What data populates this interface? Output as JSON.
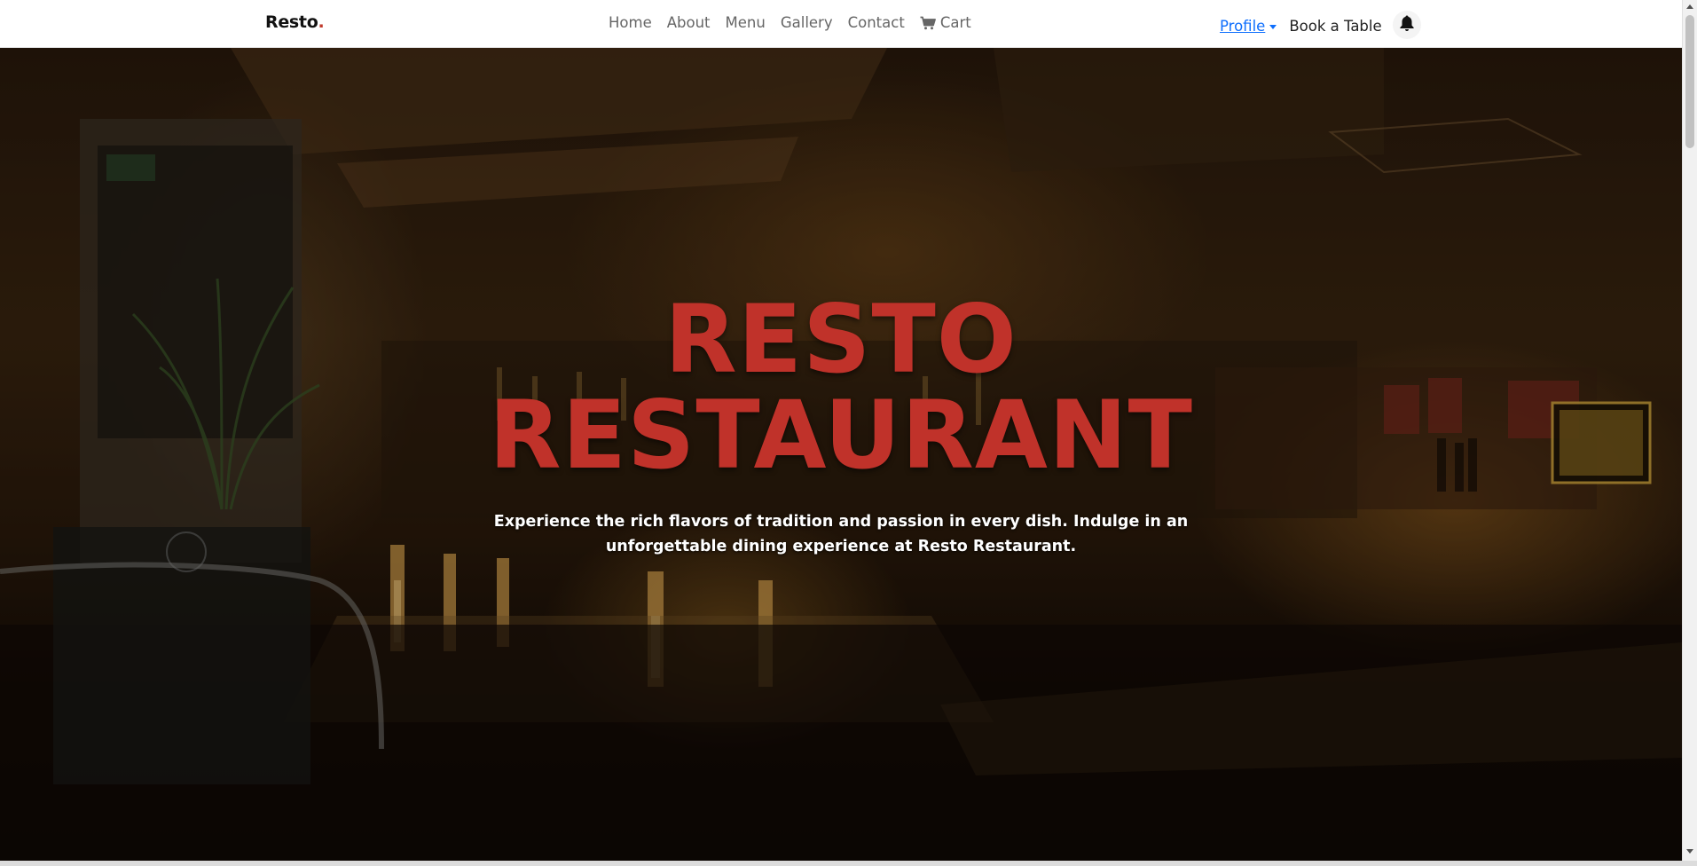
{
  "brand": {
    "name": "Resto",
    "dot": "."
  },
  "nav": {
    "links": [
      "Home",
      "About",
      "Menu",
      "Gallery",
      "Contact"
    ],
    "cart_label": "Cart"
  },
  "nav_right": {
    "profile_label": "Profile",
    "book_label": "Book a Table"
  },
  "hero": {
    "title_line1": "RESTO",
    "title_line2": "RESTAURANT",
    "subtitle": "Experience the rich flavors of tradition and passion in every dish. Indulge in an unforgettable dining experience at Resto Restaurant."
  },
  "icons": {
    "cart": "cart-icon",
    "bell": "bell-icon",
    "caret": "chevron-down-icon"
  },
  "colors": {
    "accent_red": "#c0322a",
    "link_blue": "#0d6efd",
    "nav_text": "#666666"
  }
}
